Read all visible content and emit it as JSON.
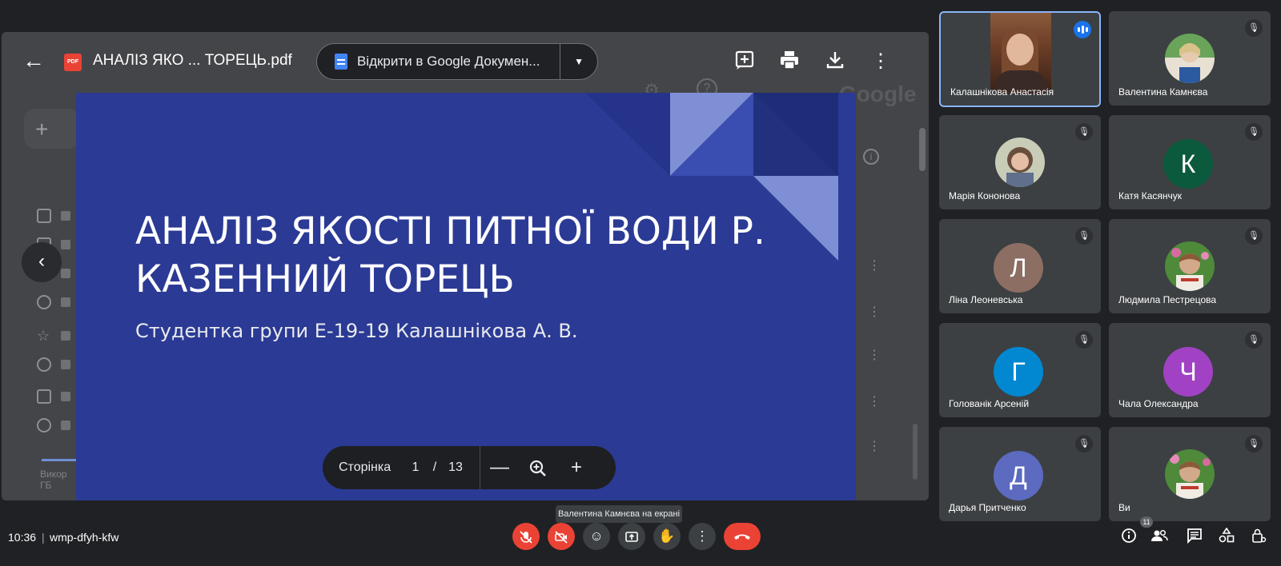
{
  "viewer": {
    "file_title": "АНАЛІЗ ЯКО ... ТОРЕЦЬ.pdf",
    "pdf_badge": "PDF",
    "open_in_docs_label": "Відкрити в Google Докумен...",
    "drive_bg": {
      "google_text": "Google",
      "storage_text": "Викор\nГБ"
    }
  },
  "slide": {
    "title_line1": "АНАЛІЗ ЯКОСТІ ПИТНОЇ ВОДИ Р.",
    "title_line2": "КАЗЕННИЙ ТОРЕЦЬ",
    "subtitle": "Студентка групи Е-19-19 Калашнікова А. В.",
    "bg_color": "#2b3a94"
  },
  "page_control": {
    "label": "Сторінка",
    "current": "1",
    "separator": "/",
    "total": "13"
  },
  "participants": [
    {
      "name": "Калашнікова Анастасія",
      "kind": "video",
      "speaking": true
    },
    {
      "name": "Валентина Камнєва",
      "kind": "photo"
    },
    {
      "name": "Марія Кононова",
      "kind": "photo"
    },
    {
      "name": "Катя Касянчук",
      "kind": "initial",
      "initial": "К",
      "color": "#0b5a3d"
    },
    {
      "name": "Ліна Леоневська",
      "kind": "initial",
      "initial": "Л",
      "color": "#8d6e63"
    },
    {
      "name": "Людмила Пестрецова",
      "kind": "photo"
    },
    {
      "name": "Голованік Арсеній",
      "kind": "initial",
      "initial": "Г",
      "color": "#0288d1"
    },
    {
      "name": "Чала Олександра",
      "kind": "initial",
      "initial": "Ч",
      "color": "#a142c4"
    },
    {
      "name": "Дарья Притченко",
      "kind": "initial",
      "initial": "Д",
      "color": "#5c6bc0"
    },
    {
      "name": "Ви",
      "kind": "photo"
    }
  ],
  "meeting": {
    "time": "10:36",
    "separator": "|",
    "code": "wmp-dfyh-kfw",
    "presenting_tooltip": "Валентина Камнєва на екрані",
    "people_count": "11"
  },
  "colors": {
    "accent_blue": "#8ab4f8",
    "end_call_red": "#ea4335",
    "tile_bg": "#3c4043"
  }
}
